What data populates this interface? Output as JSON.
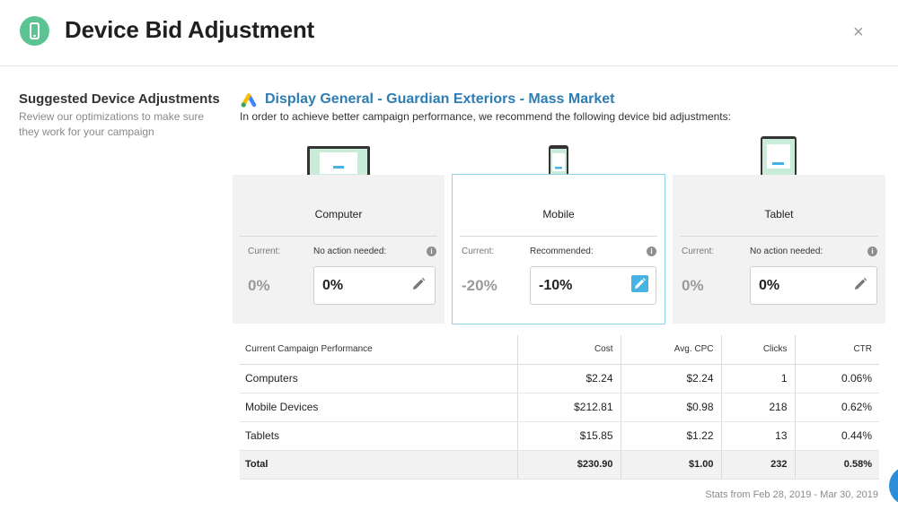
{
  "header": {
    "title": "Device Bid Adjustment",
    "icon": "mobile-phone-icon",
    "icon_color": "#5cc492",
    "close_symbol": "×"
  },
  "sidebar": {
    "title": "Suggested Device Adjustments",
    "description": "Review our optimizations to make sure they work for your campaign"
  },
  "campaign": {
    "logo": "google-ads-icon",
    "name": "Display General - Guardian Exteriors - Mass Market",
    "name_color": "#2d7db3",
    "intro": "In order to achieve better campaign performance, we recommend the following device bid adjustments:"
  },
  "devices": [
    {
      "name": "Computer",
      "current_label": "Current:",
      "current_value": "0%",
      "action_label": "No action needed:",
      "bid_value": "0%",
      "selected": false
    },
    {
      "name": "Mobile",
      "current_label": "Current:",
      "current_value": "-20%",
      "action_label": "Recommended:",
      "bid_value": "-10%",
      "selected": true
    },
    {
      "name": "Tablet",
      "current_label": "Current:",
      "current_value": "0%",
      "action_label": "No action needed:",
      "bid_value": "0%",
      "selected": false
    }
  ],
  "table": {
    "headers": [
      "Current Campaign Performance",
      "Cost",
      "Avg. CPC",
      "Clicks",
      "CTR"
    ],
    "rows": [
      [
        "Computers",
        "$2.24",
        "$2.24",
        "1",
        "0.06%"
      ],
      [
        "Mobile Devices",
        "$212.81",
        "$0.98",
        "218",
        "0.62%"
      ],
      [
        "Tablets",
        "$15.85",
        "$1.22",
        "13",
        "0.44%"
      ]
    ],
    "total": [
      "Total",
      "$230.90",
      "$1.00",
      "232",
      "0.58%"
    ]
  },
  "stats_range": "Stats from Feb 28, 2019 - Mar 30, 2019",
  "accent_color": "#47b3e4"
}
